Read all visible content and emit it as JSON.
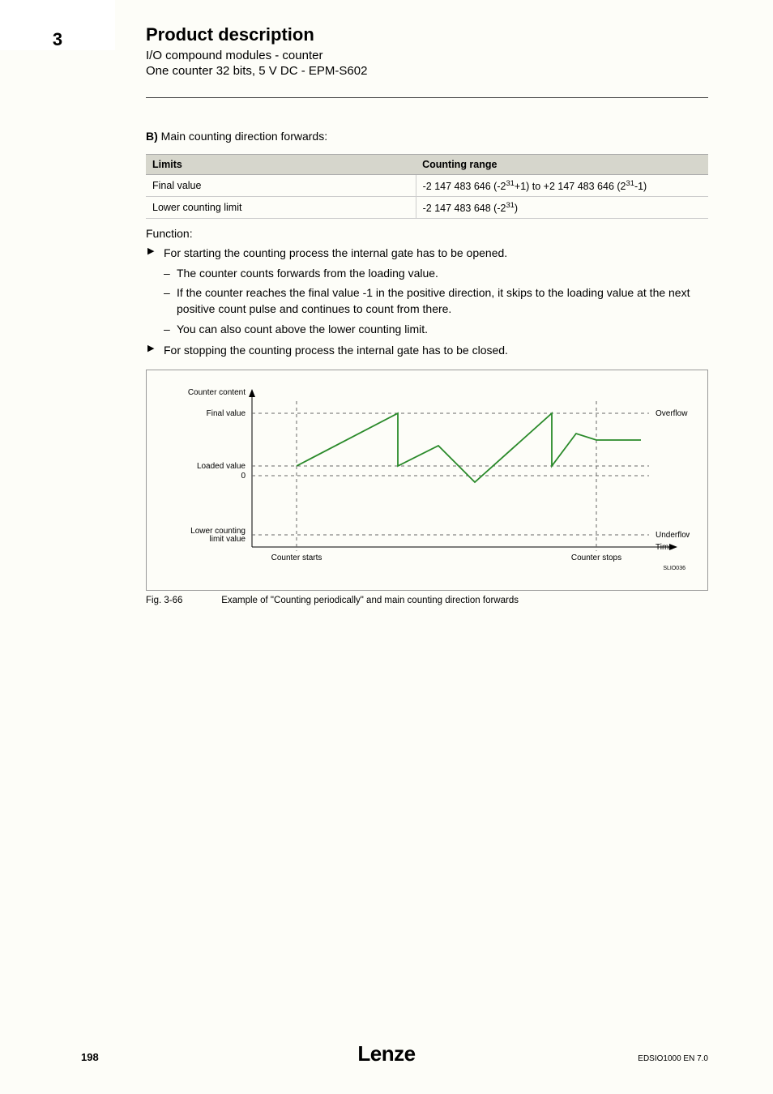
{
  "chapter_number": "3",
  "header": {
    "title": "Product description",
    "sub1": "I/O compound modules - counter",
    "sub2": "One counter 32 bits, 5 V DC - EPM-S602"
  },
  "section_b": {
    "prefix": "B)",
    "text": "Main counting direction forwards:"
  },
  "table": {
    "head_limits": "Limits",
    "head_range": "Counting range",
    "rows": [
      {
        "limit": "Final value",
        "range_plain": "-2 147 483 646 (-2^31+1) to +2 147 483 646 (2^31-1)"
      },
      {
        "limit": "Lower counting limit",
        "range_plain": "-2 147 483 648 (-2^31)"
      }
    ],
    "row0_range_html_parts": {
      "a": "-2 147 483 646 (-2",
      "a_sup": "31",
      "b": "+1) to +2 147 483 646 (2",
      "b_sup": "31",
      "c": "-1)"
    },
    "row1_range_html_parts": {
      "a": "-2 147 483 648 (-2",
      "a_sup": "31",
      "b": ")"
    }
  },
  "function_label": "Function:",
  "bullets": [
    {
      "text": "For starting the counting process the internal gate has to be opened.",
      "subs": [
        "The counter counts forwards from the loading value.",
        "If the counter reaches the final value -1 in the positive direction, it skips to the loading value at the next positive count pulse and continues to count from there.",
        "You can also count above the lower counting limit."
      ]
    },
    {
      "text": "For stopping the counting process the internal gate has to be closed.",
      "subs": []
    }
  ],
  "figure": {
    "labels": {
      "counter_content": "Counter content",
      "final_value": "Final value",
      "loaded_value": "Loaded value",
      "zero": "0",
      "lower_limit": "Lower counting\nlimit value",
      "overflow": "Overflow",
      "underflow": "Underflow",
      "time": "Time",
      "counter_starts": "Counter starts",
      "counter_stops": "Counter stops",
      "fig_code": "SLIO036"
    },
    "caption_num": "Fig. 3-66",
    "caption_text": "Example of \"Counting periodically\" and main counting direction forwards"
  },
  "chart_data": {
    "type": "line",
    "title": "Counting periodically, main counting direction forwards",
    "xlabel": "Time",
    "ylabel": "Counter content",
    "y_levels": {
      "final_value": 30,
      "loaded_value": 5,
      "zero": 0,
      "lower_counting_limit": -30
    },
    "events": {
      "counter_starts_x": 10,
      "counter_stops_x": 70
    },
    "series": [
      {
        "name": "Counter content",
        "points": [
          {
            "x": 10,
            "y": 5
          },
          {
            "x": 30,
            "y": 30
          },
          {
            "x": 30,
            "y": 5
          },
          {
            "x": 38,
            "y": 15
          },
          {
            "x": 45,
            "y": -3
          },
          {
            "x": 60,
            "y": 30
          },
          {
            "x": 60,
            "y": 5
          },
          {
            "x": 65,
            "y": 20
          },
          {
            "x": 70,
            "y": 17
          },
          {
            "x": 78,
            "y": 17
          }
        ]
      }
    ],
    "annotations": [
      {
        "text": "Overflow",
        "x": 80,
        "y": 30
      },
      {
        "text": "Underflow",
        "x": 80,
        "y": -30
      }
    ]
  },
  "footer": {
    "page": "198",
    "brand": "Lenze",
    "docid": "EDSIO1000 EN 7.0"
  }
}
